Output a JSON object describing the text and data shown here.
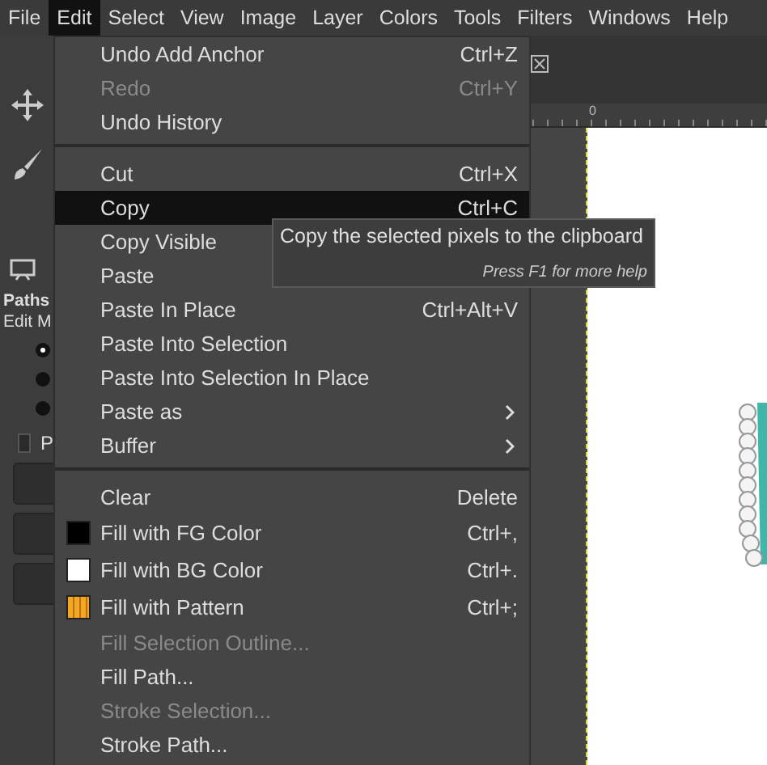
{
  "menubar": [
    {
      "label": "File",
      "selected": false
    },
    {
      "label": "Edit",
      "selected": true
    },
    {
      "label": "Select",
      "selected": false
    },
    {
      "label": "View",
      "selected": false
    },
    {
      "label": "Image",
      "selected": false
    },
    {
      "label": "Layer",
      "selected": false
    },
    {
      "label": "Colors",
      "selected": false
    },
    {
      "label": "Tools",
      "selected": false
    },
    {
      "label": "Filters",
      "selected": false
    },
    {
      "label": "Windows",
      "selected": false
    },
    {
      "label": "Help",
      "selected": false
    }
  ],
  "dock": {
    "title": "Paths",
    "subtitle": "Edit M",
    "modes": [
      {
        "selected": true
      },
      {
        "selected": false
      },
      {
        "selected": false
      }
    ],
    "option": {
      "label": "P",
      "checked": false
    }
  },
  "image_window": {
    "ruler_label": "0"
  },
  "menu": {
    "items": [
      {
        "kind": "item",
        "label": "Undo Add Anchor",
        "shortcut": "Ctrl+Z",
        "disabled": false,
        "selected": false,
        "submenu": false
      },
      {
        "kind": "item",
        "label": "Redo",
        "shortcut": "Ctrl+Y",
        "disabled": true,
        "selected": false,
        "submenu": false
      },
      {
        "kind": "item",
        "label": "Undo History",
        "disabled": false,
        "selected": false,
        "submenu": false
      },
      {
        "kind": "separator"
      },
      {
        "kind": "item",
        "label": "Cut",
        "shortcut": "Ctrl+X",
        "disabled": false,
        "selected": false,
        "submenu": false
      },
      {
        "kind": "item",
        "label": "Copy",
        "shortcut": "Ctrl+C",
        "disabled": false,
        "selected": true,
        "submenu": false
      },
      {
        "kind": "item",
        "label": "Copy Visible",
        "disabled": false,
        "selected": false,
        "submenu": false
      },
      {
        "kind": "item",
        "label": "Paste",
        "disabled": false,
        "selected": false,
        "submenu": false
      },
      {
        "kind": "item",
        "label": "Paste In Place",
        "shortcut": "Ctrl+Alt+V",
        "disabled": false,
        "selected": false,
        "submenu": false
      },
      {
        "kind": "item",
        "label": "Paste Into Selection",
        "disabled": false,
        "selected": false,
        "submenu": false
      },
      {
        "kind": "item",
        "label": "Paste Into Selection In Place",
        "disabled": false,
        "selected": false,
        "submenu": false
      },
      {
        "kind": "item",
        "label": "Paste as",
        "disabled": false,
        "selected": false,
        "submenu": true
      },
      {
        "kind": "item",
        "label": "Buffer",
        "disabled": false,
        "selected": false,
        "submenu": true
      },
      {
        "kind": "separator"
      },
      {
        "kind": "item",
        "label": "Clear",
        "shortcut": "Delete",
        "disabled": false,
        "selected": false,
        "submenu": false
      },
      {
        "kind": "item",
        "label": "Fill with FG Color",
        "shortcut": "Ctrl+,",
        "disabled": false,
        "selected": false,
        "submenu": false,
        "swatch": {
          "kind": "color",
          "color": "#000000"
        }
      },
      {
        "kind": "item",
        "label": "Fill with BG Color",
        "shortcut": "Ctrl+.",
        "disabled": false,
        "selected": false,
        "submenu": false,
        "swatch": {
          "kind": "color",
          "color": "#ffffff"
        }
      },
      {
        "kind": "item",
        "label": "Fill with Pattern",
        "shortcut": "Ctrl+;",
        "disabled": false,
        "selected": false,
        "submenu": false,
        "swatch": {
          "kind": "pattern",
          "color": "#f5a623"
        }
      },
      {
        "kind": "item",
        "label": "Fill Selection Outline...",
        "disabled": true,
        "selected": false,
        "submenu": false
      },
      {
        "kind": "item",
        "label": "Fill Path...",
        "disabled": false,
        "selected": false,
        "submenu": false
      },
      {
        "kind": "item",
        "label": "Stroke Selection...",
        "disabled": true,
        "selected": false,
        "submenu": false
      },
      {
        "kind": "item",
        "label": "Stroke Path...",
        "disabled": false,
        "selected": false,
        "submenu": false
      }
    ]
  },
  "tooltip": {
    "text": "Copy the selected pixels to the clipboard",
    "hint": "Press F1 for more help"
  }
}
